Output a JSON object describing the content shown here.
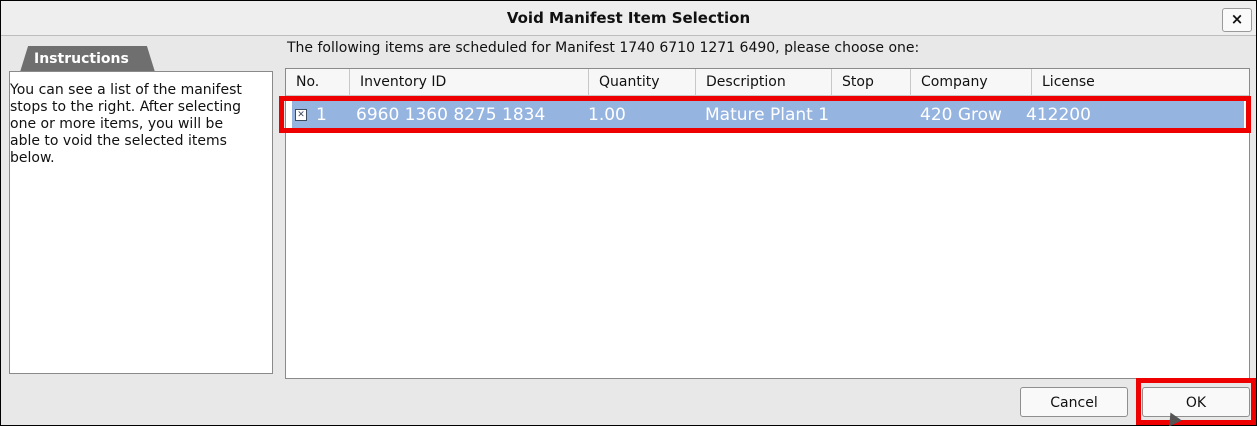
{
  "window": {
    "title": "Void Manifest Item Selection",
    "close_label": "×"
  },
  "instructions": {
    "tab_label": "Instructions",
    "text": "You can see a list of the manifest stops to the right. After selecting one or more items, you will be able to void the selected items below."
  },
  "main": {
    "header": "The following items are scheduled for Manifest 1740 6710 1271 6490, please choose one:",
    "columns": [
      "No.",
      "Inventory ID",
      "Quantity",
      "Description",
      "Stop",
      "Company",
      "License"
    ],
    "rows": [
      {
        "selected": true,
        "no": "1",
        "inventory_id": "6960 1360 8275 1834",
        "quantity": "1.00",
        "description": "Mature Plant 1",
        "stop": "",
        "company": "420 Grow",
        "license": "412200"
      }
    ]
  },
  "footer": {
    "cancel_label": "Cancel",
    "ok_label": "OK"
  },
  "colors": {
    "selected_row": "#96b4e0",
    "highlight": "#ee0000"
  }
}
